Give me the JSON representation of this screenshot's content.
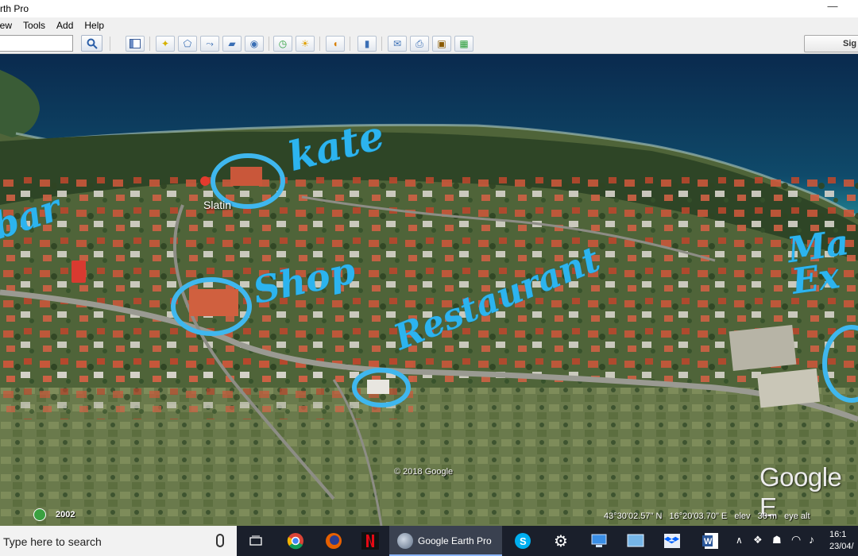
{
  "window": {
    "title": "rth Pro",
    "minimize": "—"
  },
  "menu": [
    "iew",
    "Tools",
    "Add",
    "Help"
  ],
  "toolbar": {
    "search_value": "",
    "signin_label": "Sig",
    "buttons": [
      "search-icon",
      "sidebar-icon",
      "placemark-icon",
      "polygon-icon",
      "path-icon",
      "overlay-icon",
      "record-tour-icon",
      "historical-imagery-icon",
      "sunlight-icon",
      "planets-icon",
      "ruler-icon",
      "email-icon",
      "print-icon",
      "save-image-icon",
      "map-view-icon"
    ]
  },
  "map": {
    "place_label": "Slatin",
    "copyright": "© 2018 Google",
    "logo": "Google E",
    "imagery_year": "2002",
    "status": {
      "lat": "43°30'02.57\" N",
      "lon": "16°20'03.70\" E",
      "elev_label": "elev",
      "elev_value": "30 m",
      "eye_label": "eye alt"
    },
    "annotations": {
      "kate": "kate",
      "shop": "Shop",
      "restaurant": "Restaurant",
      "bar": "bar",
      "right": "Ma Ex"
    },
    "colors": {
      "sea_deep": "#0b2f56",
      "sea_shallow": "#1f7e8e",
      "annotation": "#2cb4ef"
    }
  },
  "taskbar": {
    "search_placeholder": "Type here to search",
    "active_app": "Google Earth Pro",
    "time": "16:1",
    "date": "23/04/"
  }
}
